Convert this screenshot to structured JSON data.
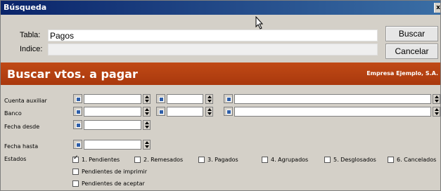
{
  "window": {
    "title": "Búsqueda"
  },
  "search": {
    "tabla_label": "Tabla:",
    "tabla_value": "Pagos",
    "indice_label": "Indice:",
    "indice_value": "",
    "buscar_button": "Buscar",
    "cancelar_button": "Cancelar"
  },
  "banner": {
    "title": "Buscar vtos. a pagar",
    "company": "Empresa Ejemplo, S.A."
  },
  "filters": {
    "cuenta_auxiliar": "Cuenta auxiliar",
    "banco": "Banco",
    "fecha_desde": "Fecha desde",
    "fecha_hasta": "Fecha hasta",
    "estados": "Estados"
  },
  "estados": [
    {
      "label": "1. Pendientes",
      "checked": true
    },
    {
      "label": "2. Remesados",
      "checked": false
    },
    {
      "label": "3. Pagados",
      "checked": false
    },
    {
      "label": "4. Agrupados",
      "checked": false
    },
    {
      "label": "5. Desglosados",
      "checked": false
    },
    {
      "label": "6. Cancelados",
      "checked": false
    },
    {
      "label": "Pendientes de imprimir",
      "checked": false
    },
    {
      "label": "Pendientes de aceptar",
      "checked": false
    }
  ],
  "colors": {
    "titlebar": "#0a246a",
    "banner": "#b3400f",
    "dialog": "#d4d0c8"
  }
}
